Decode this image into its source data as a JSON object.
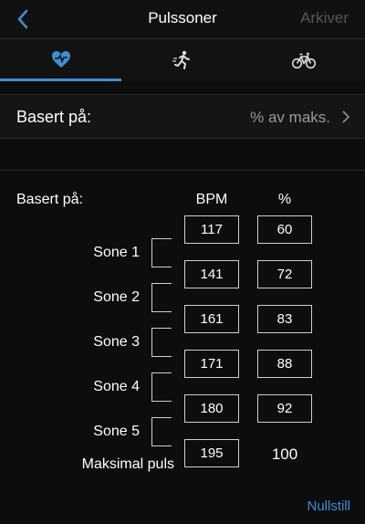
{
  "header": {
    "title": "Pulssoner",
    "archive_label": "Arkiver"
  },
  "tabs": [
    {
      "icon": "heart-icon",
      "active": true
    },
    {
      "icon": "running-icon",
      "active": false
    },
    {
      "icon": "bicycle-icon",
      "active": false
    }
  ],
  "setting": {
    "label": "Basert på:",
    "value": "% av maks."
  },
  "table": {
    "based_label": "Basert på:",
    "col_bpm": "BPM",
    "col_pct": "%",
    "zones": [
      "Sone 1",
      "Sone 2",
      "Sone 3",
      "Sone 4",
      "Sone 5"
    ],
    "bpm_values": [
      "117",
      "141",
      "161",
      "171",
      "180"
    ],
    "pct_values": [
      "60",
      "72",
      "83",
      "88",
      "92"
    ],
    "max_label": "Maksimal puls",
    "max_bpm": "195",
    "max_pct": "100"
  },
  "reset_label": "Nullstill",
  "colors": {
    "accent": "#3d8fd6",
    "background": "#0d0d0d"
  }
}
